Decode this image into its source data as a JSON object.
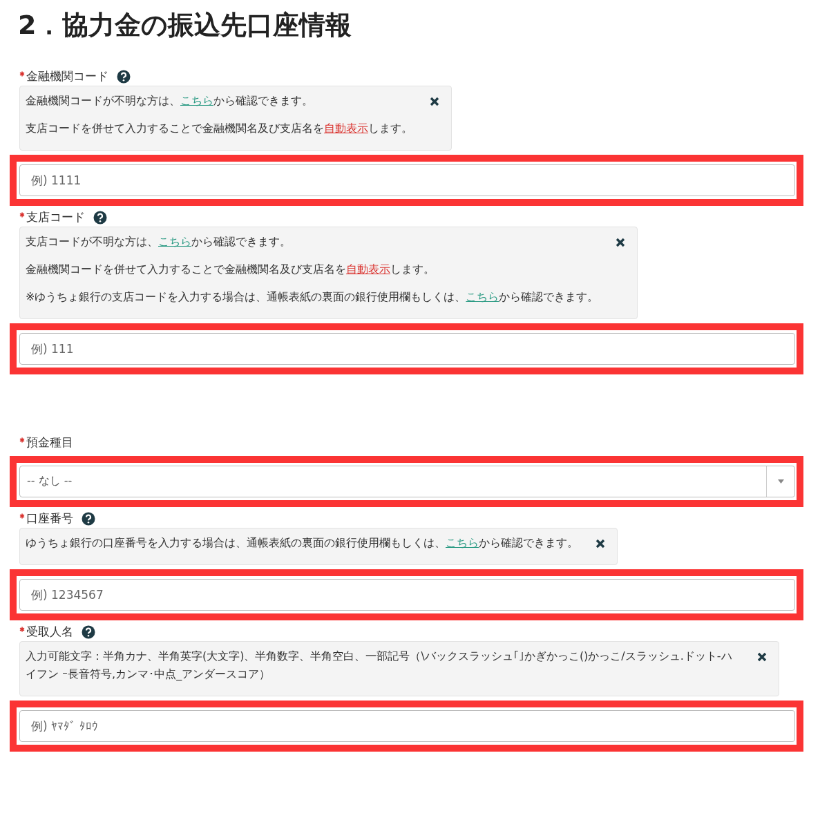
{
  "title": "2．協力金の振込先口座情報",
  "fields": [
    {
      "kind": "text",
      "label": "金融機関コード",
      "required": true,
      "help_icon": true,
      "highlighted": true,
      "placeholder": "例) 1111",
      "help": [
        [
          {
            "kind": "text",
            "text": "金融機関コードが不明な方は、"
          },
          {
            "kind": "link",
            "text": "こちら"
          },
          {
            "kind": "text",
            "text": "から確認できます。"
          }
        ],
        [
          {
            "kind": "text",
            "text": "支店コードを併せて入力することで金融機関名及び支店名を"
          },
          {
            "kind": "alert_link",
            "text": "自動表示"
          },
          {
            "kind": "text",
            "text": "します。"
          }
        ]
      ]
    },
    {
      "kind": "text",
      "label": "支店コード",
      "required": true,
      "help_icon": true,
      "highlighted": true,
      "placeholder": "例) 111",
      "help": [
        [
          {
            "kind": "text",
            "text": "支店コードが不明な方は、"
          },
          {
            "kind": "link",
            "text": "こちら"
          },
          {
            "kind": "text",
            "text": "から確認できます。"
          }
        ],
        [
          {
            "kind": "text",
            "text": "金融機関コードを併せて入力することで金融機関名及び支店名を"
          },
          {
            "kind": "alert_link",
            "text": "自動表示"
          },
          {
            "kind": "text",
            "text": "します。"
          }
        ],
        [
          {
            "kind": "text",
            "text": "※ゆうちょ銀行の支店コードを入力する場合は、通帳表紙の裏面の銀行使用欄もしくは、"
          },
          {
            "kind": "link",
            "text": "こちら"
          },
          {
            "kind": "text",
            "text": "から確認できます。"
          }
        ]
      ]
    },
    {
      "kind": "select",
      "label": "預金種目",
      "required": true,
      "help_icon": false,
      "highlighted": true,
      "value": "-- なし --"
    },
    {
      "kind": "text",
      "label": "口座番号",
      "required": true,
      "help_icon": true,
      "highlighted": true,
      "placeholder": "例) 1234567",
      "help": [
        [
          {
            "kind": "text",
            "text": "ゆうちょ銀行の口座番号を入力する場合は、通帳表紙の裏面の銀行使用欄もしくは、"
          },
          {
            "kind": "link",
            "text": "こちら"
          },
          {
            "kind": "text",
            "text": "から確認できます。"
          }
        ]
      ]
    },
    {
      "kind": "text",
      "label": "受取人名",
      "required": true,
      "help_icon": true,
      "highlighted": true,
      "placeholder": "例) ﾔﾏﾀﾞ ﾀﾛｳ",
      "help": [
        [
          {
            "kind": "text",
            "text": "入力可能文字：半角カナ、半角英字(大文字)、半角数字、半角空白、一部記号（\\バックスラッシュ｢｣かぎかっこ()かっこ/スラッシュ.ドット-ハイフン ｰ長音符号,カンマ･中点_アンダースコア）"
          }
        ]
      ]
    }
  ]
}
